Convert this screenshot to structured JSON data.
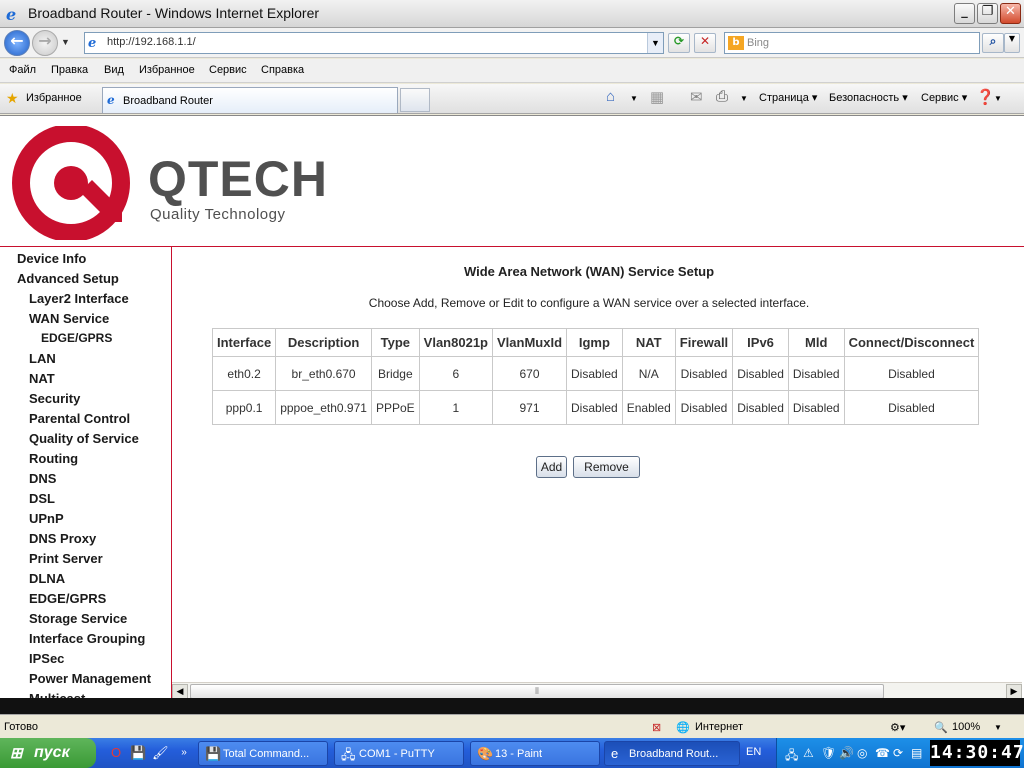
{
  "window": {
    "title": "Broadband Router - Windows Internet Explorer",
    "minimize": "_",
    "maximize": "❐",
    "close": "✕"
  },
  "address": {
    "url": "http://192.168.1.1/",
    "search_placeholder": "Bing",
    "bing_glyph": "b"
  },
  "menu": {
    "items": [
      "Файл",
      "Правка",
      "Вид",
      "Избранное",
      "Сервис",
      "Справка"
    ]
  },
  "favorites": {
    "label": "Избранное",
    "tab_title": "Broadband Router",
    "commands": [
      "Страница ▾",
      "Безопасность ▾",
      "Сервис ▾"
    ]
  },
  "brand": {
    "name": "QTECH",
    "tagline": "Quality Technology",
    "color": "#c8102e"
  },
  "sidebar": {
    "items": [
      {
        "label": "Device Info",
        "level": 0
      },
      {
        "label": "Advanced Setup",
        "level": 0
      },
      {
        "label": "Layer2 Interface",
        "level": 1
      },
      {
        "label": "WAN Service",
        "level": 1
      },
      {
        "label": "EDGE/GPRS",
        "level": 2
      },
      {
        "label": "LAN",
        "level": 1
      },
      {
        "label": "NAT",
        "level": 1
      },
      {
        "label": "Security",
        "level": 1
      },
      {
        "label": "Parental Control",
        "level": 1
      },
      {
        "label": "Quality of Service",
        "level": 1
      },
      {
        "label": "Routing",
        "level": 1
      },
      {
        "label": "DNS",
        "level": 1
      },
      {
        "label": "DSL",
        "level": 1
      },
      {
        "label": "UPnP",
        "level": 1
      },
      {
        "label": "DNS Proxy",
        "level": 1
      },
      {
        "label": "Print Server",
        "level": 1
      },
      {
        "label": "DLNA",
        "level": 1
      },
      {
        "label": "EDGE/GPRS",
        "level": 1
      },
      {
        "label": "Storage Service",
        "level": 1
      },
      {
        "label": "Interface Grouping",
        "level": 1
      },
      {
        "label": "IPSec",
        "level": 1
      },
      {
        "label": "Power Management",
        "level": 1
      },
      {
        "label": "Multicast",
        "level": 1
      }
    ]
  },
  "main": {
    "heading": "Wide Area Network (WAN) Service Setup",
    "description": "Choose Add, Remove or Edit to configure a WAN service over a selected interface.",
    "table": {
      "columns": [
        "Interface",
        "Description",
        "Type",
        "Vlan8021p",
        "VlanMuxId",
        "Igmp",
        "NAT",
        "Firewall",
        "IPv6",
        "Mld",
        "Connect/Disconnect"
      ],
      "rows": [
        [
          "eth0.2",
          "br_eth0.670",
          "Bridge",
          "6",
          "670",
          "Disabled",
          "N/A",
          "Disabled",
          "Disabled",
          "Disabled",
          "Disabled"
        ],
        [
          "ppp0.1",
          "pppoe_eth0.971",
          "PPPoE",
          "1",
          "971",
          "Disabled",
          "Enabled",
          "Disabled",
          "Disabled",
          "Disabled",
          "Disabled"
        ]
      ]
    },
    "buttons": {
      "add": "Add",
      "remove": "Remove"
    }
  },
  "statusbar": {
    "text": "Готово",
    "zone": "Интернет",
    "zoom": "100%"
  },
  "taskbar": {
    "start": "пуск",
    "items": [
      {
        "label": "Total Command...",
        "icon": "💾",
        "active": false
      },
      {
        "label": "COM1 - PuTTY",
        "icon": "🖧",
        "active": false
      },
      {
        "label": "13 - Paint",
        "icon": "🎨",
        "active": false
      },
      {
        "label": "Broadband Rout...",
        "icon": "e",
        "active": true
      }
    ],
    "language": "EN",
    "clock": "14:30:47"
  }
}
